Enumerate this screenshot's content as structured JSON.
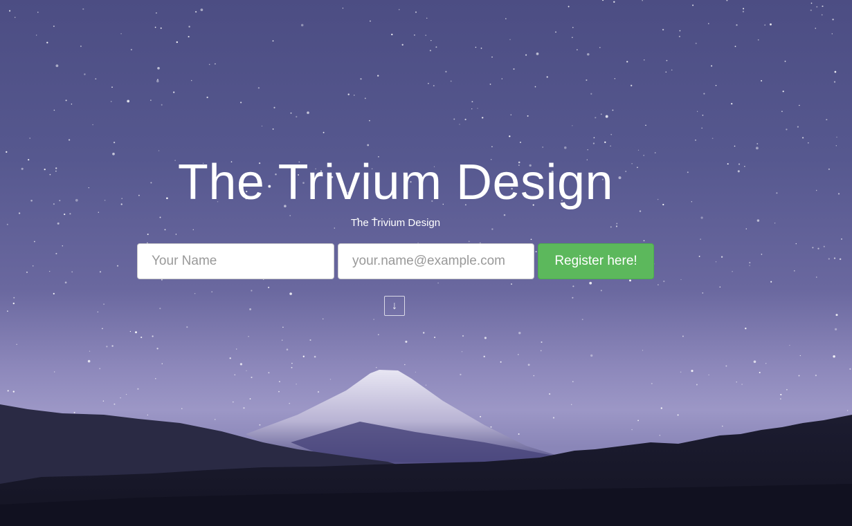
{
  "hero": {
    "title": "The Trivium Design",
    "subtitle": "The Trivium Design"
  },
  "form": {
    "name_placeholder": "Your Name",
    "email_placeholder": "your.name@example.com",
    "register_label": "Register here!"
  },
  "scroll_button": {
    "icon": "arrow-down-icon",
    "glyph": "↓"
  },
  "colors": {
    "sky_top": "#4c4d83",
    "sky_bottom": "#9c97c6",
    "register_button": "#5cb85c",
    "text": "#ffffff"
  }
}
